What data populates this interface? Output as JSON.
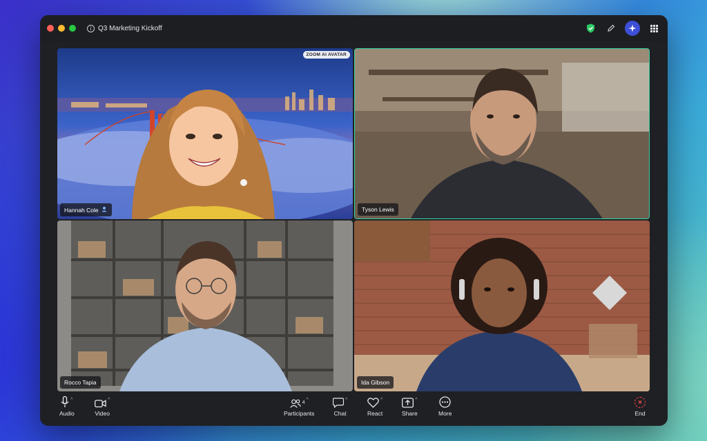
{
  "window": {
    "title": "Q3 Marketing Kickoff"
  },
  "participants": [
    {
      "name": "Hannah Cole",
      "badge": "ZOOM AI AVATAR",
      "active_speaker": false
    },
    {
      "name": "Tyson Lewis",
      "active_speaker": true
    },
    {
      "name": "Rocco Tapia",
      "active_speaker": false
    },
    {
      "name": "Ida Gibson",
      "active_speaker": false
    }
  ],
  "toolbar": {
    "audio": "Audio",
    "video": "Video",
    "participants": "Participants",
    "participants_count": "4",
    "chat": "Chat",
    "react": "React",
    "share": "Share",
    "more": "More",
    "end": "End"
  },
  "colors": {
    "active_speaker_border": "#33d6a4",
    "end_red": "#ff4a4a",
    "ai_button": "#3d4fd6"
  }
}
